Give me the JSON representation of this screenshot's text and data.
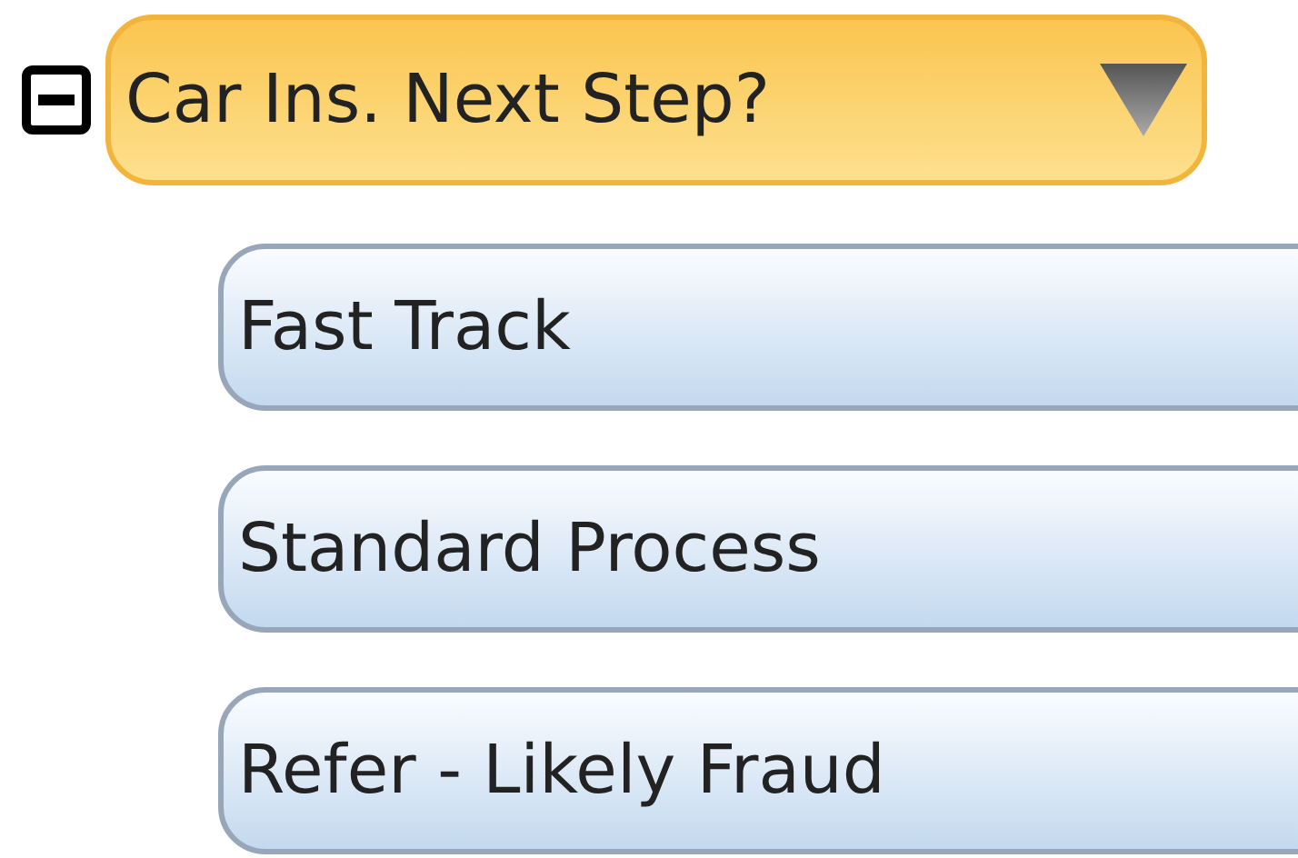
{
  "node": {
    "label": "Car Ins. Next Step?",
    "expanded": true,
    "children": [
      {
        "label": "Fast Track"
      },
      {
        "label": "Standard Process"
      },
      {
        "label": "Refer - Likely Fraud"
      }
    ]
  }
}
